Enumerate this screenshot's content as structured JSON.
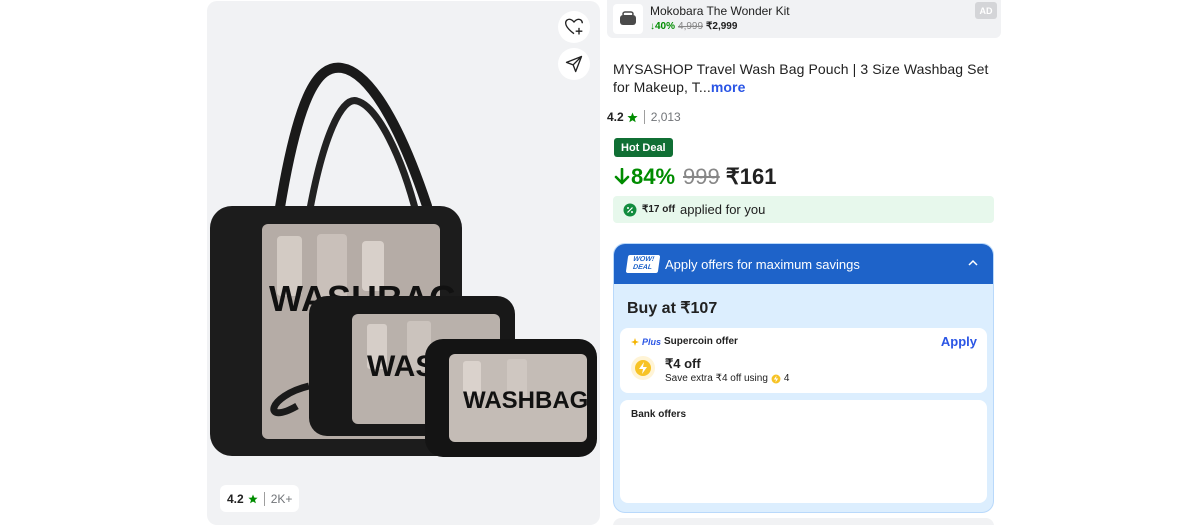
{
  "ad": {
    "title": "Mokobara The Wonder Kit",
    "discount": "40%",
    "mrp": "4,999",
    "price": "₹2,999",
    "tag": "AD"
  },
  "product": {
    "title": "MYSASHOP Travel Wash Bag Pouch | 3 Size Washbag Set for Makeup, T...",
    "more": "more",
    "rating": "4.2",
    "rating_count": "2,013",
    "image_rating": "4.2",
    "image_rating_count": "2K+",
    "bag_label": "WASHBAG"
  },
  "deal": {
    "badge": "Hot Deal",
    "discount": "84%",
    "mrp": "999",
    "price": "₹161"
  },
  "applied": {
    "amount": "₹17 off",
    "text": "applied for you"
  },
  "offers": {
    "logo_top": "WOW!",
    "logo_bottom": "DEAL",
    "header": "Apply offers for maximum savings",
    "buy_at": "Buy at ₹107",
    "plus_word": "Plus",
    "supercoin_title": "Supercoin offer",
    "apply": "Apply",
    "off_amount": "₹4 off",
    "save_extra": "Save extra ₹4 off using",
    "coins": "4",
    "bank_title": "Bank offers"
  },
  "colors": {
    "green": "#008c00",
    "hot_deal_bg": "#106f34",
    "blue": "#1e63c9",
    "link_blue": "#2a55e5"
  },
  "icons": [
    "heart-plus-icon",
    "share-icon",
    "star-icon",
    "arrow-down-icon",
    "discount-badge-icon",
    "chevron-up-icon",
    "supercoin-icon"
  ]
}
